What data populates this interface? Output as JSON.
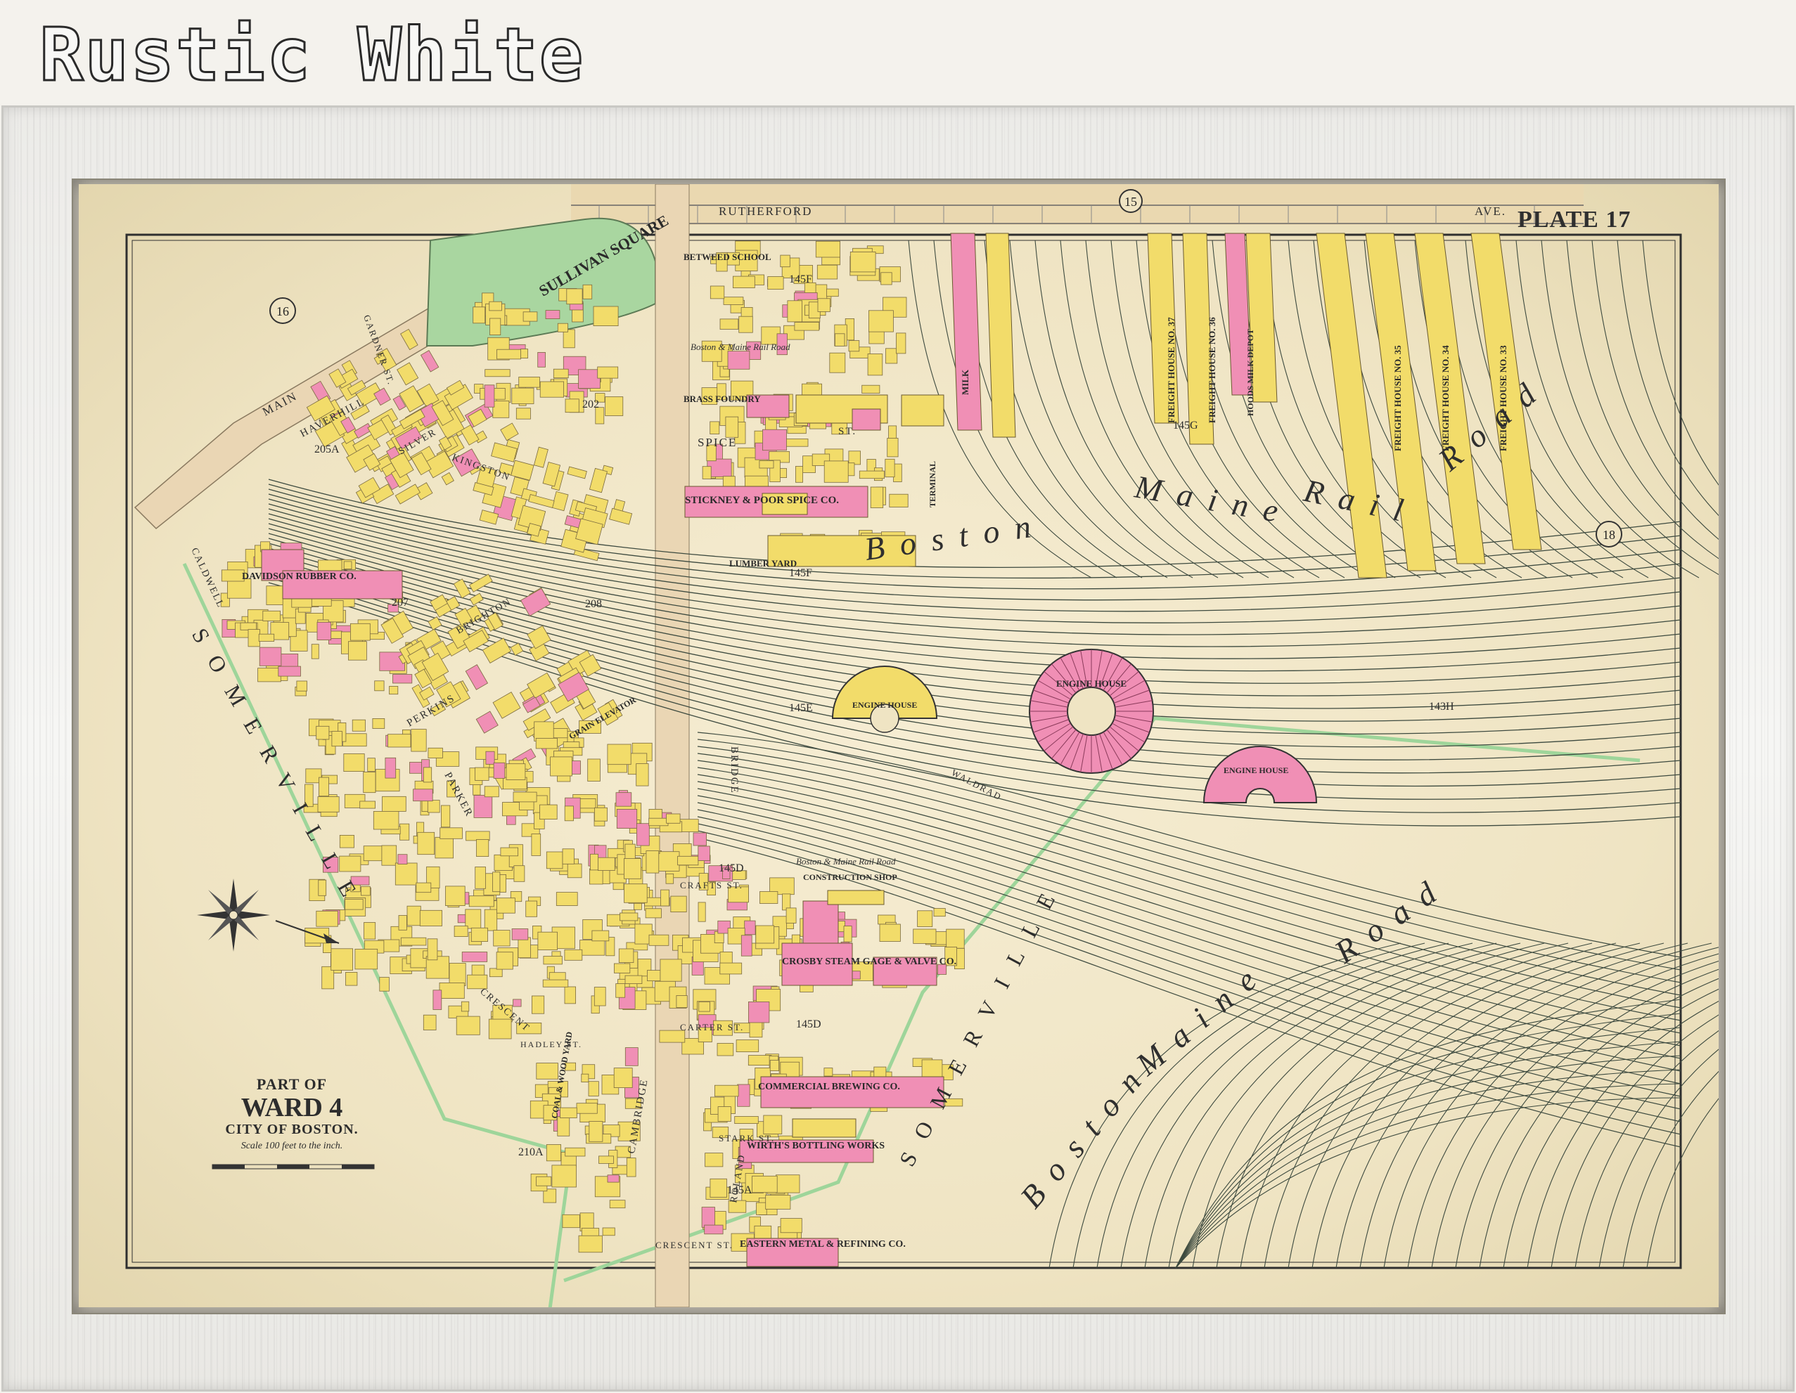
{
  "banner": {
    "title": "Rustic White"
  },
  "map": {
    "plate": "PLATE 17",
    "cartouche": {
      "line1": "PART OF",
      "line2": "WARD 4",
      "line3": "CITY OF BOSTON.",
      "scale": "Scale 100 feet to the inch."
    },
    "plate_refs": [
      "15",
      "16",
      "18"
    ],
    "streets": [
      "RUTHERFORD",
      "AVE.",
      "MAIN",
      "GARDNER ST.",
      "HAVERHILL",
      "SILVER",
      "KINGSTON",
      "SPICE",
      "ST.",
      "BRIDGE",
      "CALDWELL",
      "BRIGHTON",
      "PERKINS",
      "PARKER",
      "CRESCENT",
      "HADLEY ST.",
      "CAMBRIDGE",
      "CRAFTS ST.",
      "CARTER ST.",
      "STARK ST.",
      "ROLAND",
      "CRESCENT ST.",
      "WALDRAD"
    ],
    "places": [
      "SULLIVAN SQUARE",
      "BETWEED SCHOOL",
      "BRASS FOUNDRY",
      "STICKNEY & POOR SPICE CO.",
      "LUMBER YARD",
      "DAVIDSON RUBBER CO.",
      "GRAIN ELEVATOR",
      "CONSTRUCTION SHOP",
      "CROSBY STEAM GAGE & VALVE CO.",
      "COMMERCIAL BREWING CO.",
      "WIRTH'S BOTTLING WORKS",
      "EASTERN METAL & REFINING CO.",
      "COAL & WOOD YARD",
      "ENGINE HOUSE",
      "MILK",
      "TERMINAL",
      "HOODS MILK DEPOT",
      "FREIGHT HOUSE NO. 37",
      "FREIGHT HOUSE NO. 36",
      "FREIGHT HOUSE NO. 35",
      "FREIGHT HOUSE NO. 34",
      "FREIGHT HOUSE NO. 33"
    ],
    "railroad_labels": [
      "Boston",
      "Maine",
      "Rail",
      "Road",
      "Boston & Maine Rail Road"
    ],
    "districts": [
      "SOMERVILLE"
    ],
    "block_numbers": [
      "145F",
      "145E",
      "145D",
      "145G",
      "145A",
      "143H",
      "202",
      "205A",
      "207",
      "208",
      "210A"
    ]
  },
  "colors": {
    "paper": "#efe4c3",
    "yellow_building": "#f2dc6a",
    "pink_building": "#f08fb5",
    "green_park": "#a9d6a0",
    "track": "#3d4a3f"
  }
}
